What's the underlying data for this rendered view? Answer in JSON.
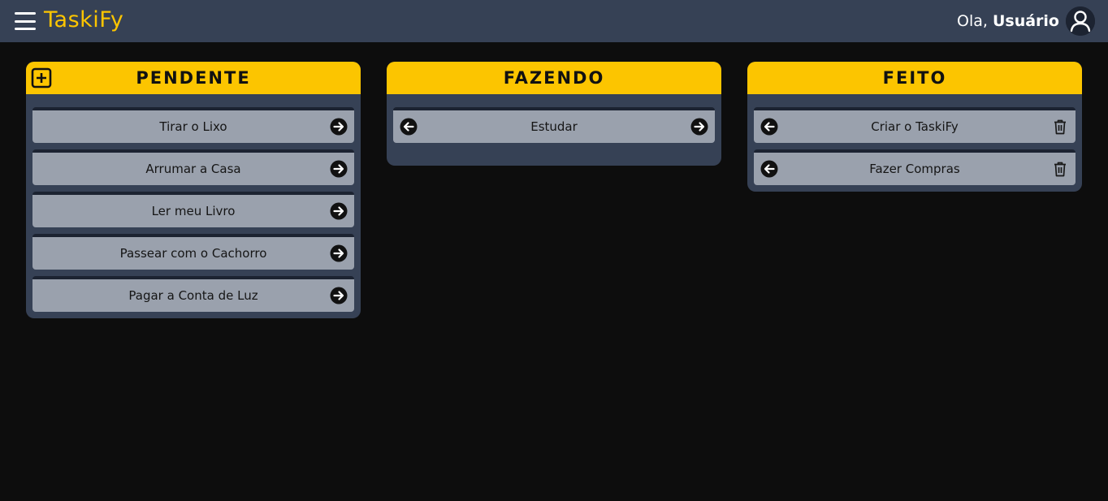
{
  "header": {
    "brand": "TaskiFy",
    "greeting_prefix": "Ola,",
    "user_name": "Usuário"
  },
  "columns": [
    {
      "title": "PENDENTE",
      "tasks": [
        "Tirar o Lixo",
        "Arrumar a Casa",
        "Ler meu Livro",
        "Passear com o Cachorro",
        "Pagar a Conta de Luz"
      ]
    },
    {
      "title": "FAZENDO",
      "tasks": [
        "Estudar"
      ]
    },
    {
      "title": "FEITO",
      "tasks": [
        "Criar o TaskiFy",
        "Fazer Compras"
      ]
    }
  ],
  "icons": {
    "menu": "hamburger-menu-icon",
    "avatar": "user-icon",
    "add": "plus-square-icon",
    "forward": "arrow-right-circle-icon",
    "back": "arrow-left-circle-icon",
    "delete": "trash-icon"
  },
  "colors": {
    "accent": "#fcc500",
    "header_bg": "#364155",
    "page_bg": "#0d0d0d",
    "card_bg": "#9aa1ad"
  }
}
